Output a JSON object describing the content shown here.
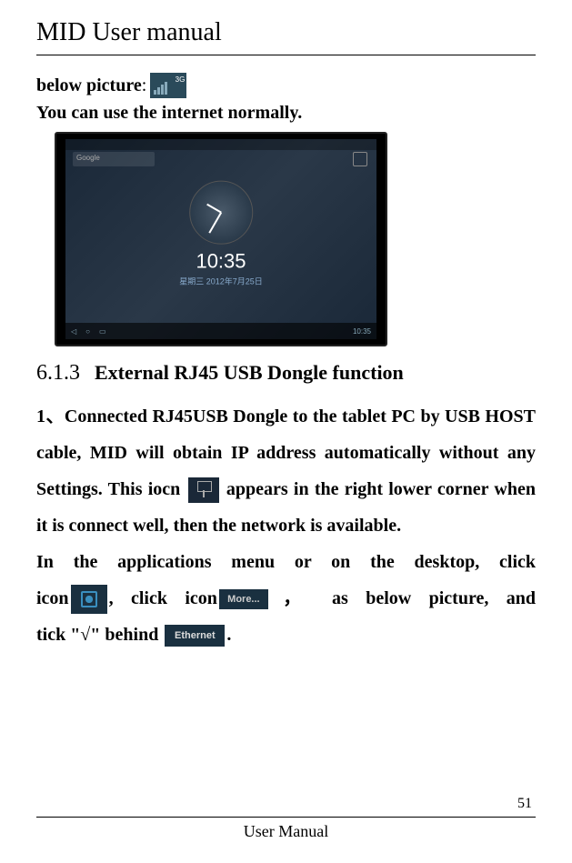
{
  "header": {
    "title": "MID User manual"
  },
  "intro": {
    "line1_prefix": "below picture",
    "line1_suffix": ": ",
    "line2": "You can use the internet normally."
  },
  "tablet_screenshot": {
    "search_placeholder": "Google",
    "time": "10:35",
    "date": "星期三 2012年7月25日",
    "statusbar_time": "10:35"
  },
  "section": {
    "number": "6.1.3",
    "title": "External RJ45 USB Dongle function"
  },
  "para1": {
    "text": "1、Connected RJ45USB Dongle to the tablet PC by USB HOST cable, MID will obtain IP address automatically without any Settings. This iocn",
    "cont": "appears in the right lower corner when it is connect well, then the network is available."
  },
  "para2": {
    "line1": "In the applications menu or on the desktop, click",
    "line2_a": "icon",
    "line2_b": ", click icon",
    "line2_c": "，  as below picture, and",
    "line3_a": "tick \"√\" behind ",
    "line3_b": "."
  },
  "icons": {
    "more_label": "More...",
    "ethernet_label": "Ethernet"
  },
  "footer": {
    "page": "51",
    "text": "User Manual"
  }
}
